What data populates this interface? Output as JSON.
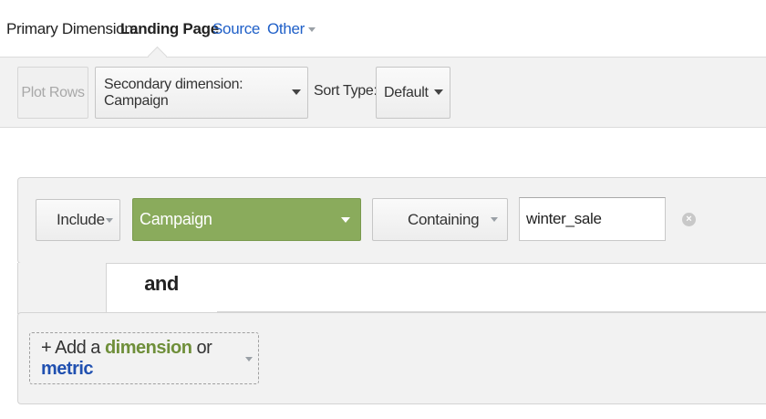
{
  "primary": {
    "label": "Primary Dimension:",
    "active": "Landing Page",
    "links": [
      "Source",
      "Other"
    ]
  },
  "toolbar": {
    "plot_rows": "Plot Rows",
    "secondary": "Secondary dimension: Campaign",
    "sort_label": "Sort Type:",
    "sort_value": "Default"
  },
  "filter": {
    "include": "Include",
    "dimension": "Campaign",
    "match_type": "Containing",
    "value": "winter_sale",
    "joiner": "and"
  },
  "add": {
    "prefix": "+ Add a",
    "dimension": "dimension",
    "or": "or",
    "metric": "metric"
  },
  "colors": {
    "link": "#2060c8",
    "campaign_bg": "#8aab5c",
    "dimension_text": "#6f8f3a",
    "metric_text": "#2050b0"
  },
  "icons": [
    "chevron-down-icon",
    "clear-icon"
  ]
}
